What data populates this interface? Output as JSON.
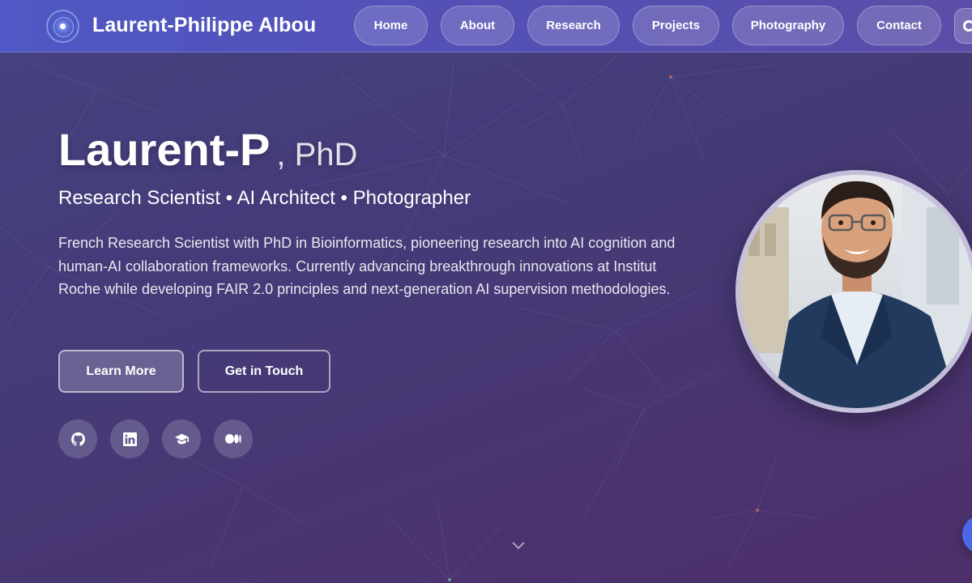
{
  "header": {
    "site_title": "Laurent-Philippe Albou",
    "nav": [
      {
        "label": "Home"
      },
      {
        "label": "About"
      },
      {
        "label": "Research"
      },
      {
        "label": "Projects"
      },
      {
        "label": "Photography"
      },
      {
        "label": "Contact"
      }
    ],
    "theme_toggle_icon": "moon-icon"
  },
  "hero": {
    "name": "Laurent-P",
    "suffix": ", PhD",
    "tagline": "Research Scientist • AI Architect • Photographer",
    "description": "French Research Scientist with PhD in Bioinformatics, pioneering research into AI cognition and human-AI collaboration frameworks. Currently advancing breakthrough innovations at Institut Roche while developing FAIR 2.0 principles and next-generation AI supervision methodologies.",
    "primary_button": "Learn More",
    "secondary_button": "Get in Touch",
    "socials": [
      {
        "icon": "github-icon"
      },
      {
        "icon": "linkedin-icon"
      },
      {
        "icon": "graduation-cap-icon"
      },
      {
        "icon": "medium-icon"
      }
    ],
    "portrait_icon": "profile-photo",
    "scroll_icon": "chevron-down-icon"
  },
  "colors": {
    "header_start": "#4f58c4",
    "background": "#45427f",
    "fab": "#4d68e6"
  }
}
